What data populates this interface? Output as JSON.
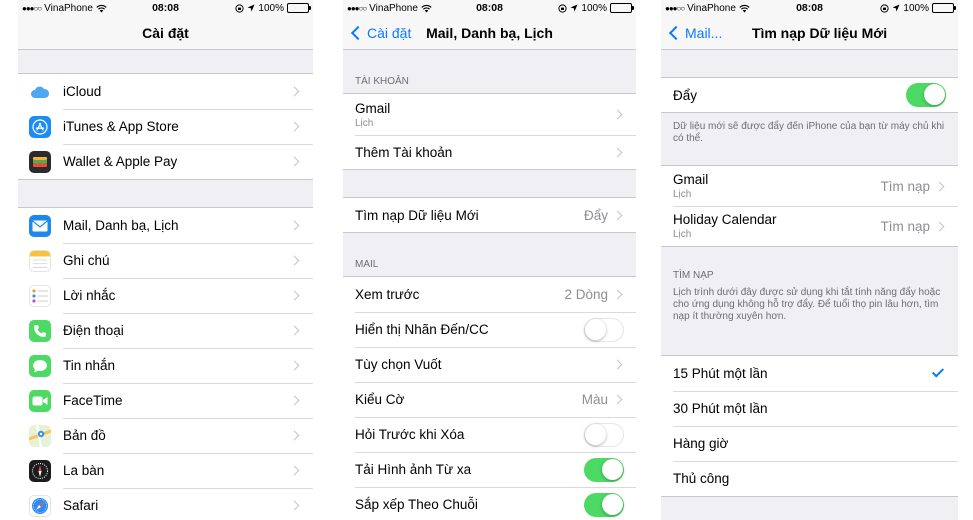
{
  "status": {
    "carrier": "VinaPhone",
    "time": "08:08",
    "battery": "100%"
  },
  "screen1": {
    "title": "Cài đặt",
    "group1": [
      {
        "label": "iCloud",
        "icon": "icloud-icon",
        "color": "#ffffff"
      },
      {
        "label": "iTunes & App Store",
        "icon": "app-store-icon",
        "color": "#1b8cf3"
      },
      {
        "label": "Wallet & Apple Pay",
        "icon": "wallet-icon",
        "color": "#2b2b2b"
      }
    ],
    "group2": [
      {
        "label": "Mail, Danh bạ, Lịch",
        "icon": "mail-icon",
        "color": "#1e87f0"
      },
      {
        "label": "Ghi chú",
        "icon": "notes-icon",
        "color": "#ffffff"
      },
      {
        "label": "Lời nhắc",
        "icon": "reminders-icon",
        "color": "#ffffff"
      },
      {
        "label": "Điện thoại",
        "icon": "phone-icon",
        "color": "#4cd964"
      },
      {
        "label": "Tin nhắn",
        "icon": "messages-icon",
        "color": "#4cd964"
      },
      {
        "label": "FaceTime",
        "icon": "facetime-icon",
        "color": "#4cd964"
      },
      {
        "label": "Bản đồ",
        "icon": "maps-icon",
        "color": "#e8f1d8"
      },
      {
        "label": "La bàn",
        "icon": "compass-icon",
        "color": "#1c1c1e"
      },
      {
        "label": "Safari",
        "icon": "safari-icon",
        "color": "#ffffff"
      }
    ]
  },
  "screen2": {
    "back": "Cài đặt",
    "title": "Mail, Danh bạ, Lịch",
    "accounts_header": "TÀI KHOẢN",
    "accounts": [
      {
        "label": "Gmail",
        "sub": "Lịch"
      },
      {
        "label": "Thêm Tài khoản"
      }
    ],
    "fetch": {
      "label": "Tìm nạp Dữ liệu Mới",
      "value": "Đẩy"
    },
    "mail_header": "MAIL",
    "mail": [
      {
        "label": "Xem trước",
        "value": "2 Dòng"
      },
      {
        "label": "Hiển thị Nhãn Đến/CC",
        "toggle": "off"
      },
      {
        "label": "Tùy chọn Vuốt"
      },
      {
        "label": "Kiểu Cờ",
        "value": "Màu"
      },
      {
        "label": "Hỏi Trước khi Xóa",
        "toggle": "off"
      },
      {
        "label": "Tải Hình ảnh Từ xa",
        "toggle": "on"
      },
      {
        "label": "Sắp xếp Theo Chuỗi",
        "toggle": "on"
      }
    ]
  },
  "screen3": {
    "back": "Mail...",
    "title": "Tìm nạp Dữ liệu Mới",
    "push": {
      "label": "Đẩy",
      "toggle": "on"
    },
    "push_note": "Dữ liệu mới sẽ được đẩy đến iPhone của bạn từ máy chủ khi có thể.",
    "accounts": [
      {
        "label": "Gmail",
        "sub": "Lịch",
        "value": "Tìm nạp"
      },
      {
        "label": "Holiday Calendar",
        "sub": "Lịch",
        "value": "Tìm nạp"
      }
    ],
    "fetch_header": "TÌM NẠP",
    "fetch_note": "Lịch trình dưới đây được sử dụng khi tắt tính năng đẩy hoặc cho ứng dụng không hỗ trợ đẩy. Để tuổi thọ pin lâu hơn, tìm nạp ít thường xuyên hơn.",
    "schedule": [
      {
        "label": "15 Phút một lần",
        "selected": true
      },
      {
        "label": "30 Phút một lần"
      },
      {
        "label": "Hàng giờ"
      },
      {
        "label": "Thủ công"
      }
    ]
  },
  "colors": {
    "accent": "#0a7aff",
    "toggle_on": "#4cd964",
    "background": "#efeff4"
  }
}
